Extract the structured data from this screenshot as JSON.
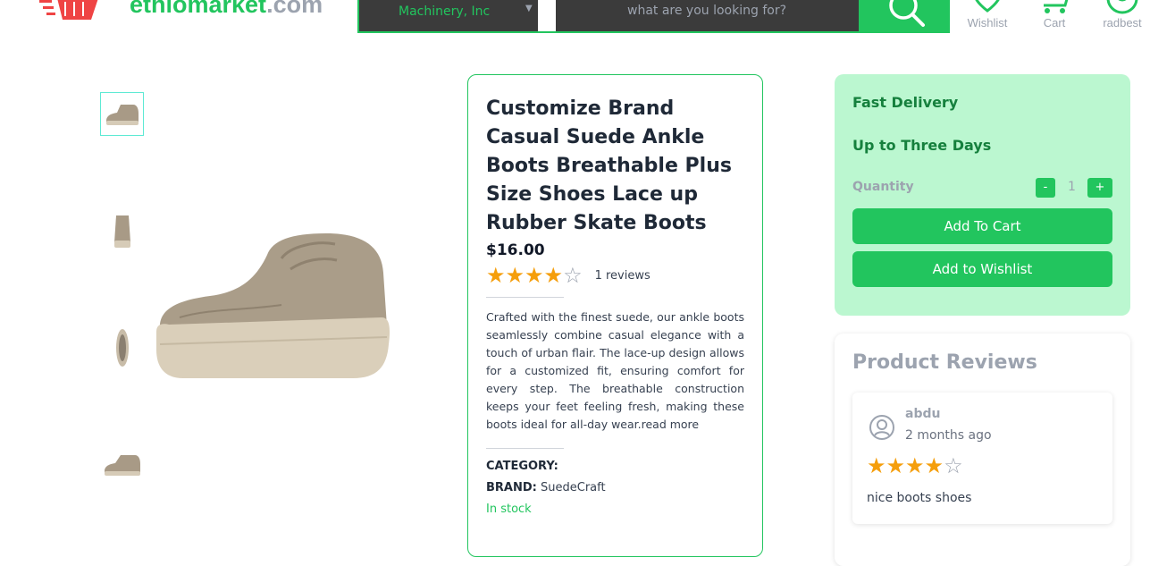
{
  "header": {
    "brand_name": "ethiomarket",
    "brand_tld": ".com",
    "category_selected": "Machinery, Inc",
    "search_placeholder": "what are you looking for?",
    "nav": [
      {
        "label": "Wishlist",
        "icon": "heart-icon"
      },
      {
        "label": "Cart",
        "icon": "cart-icon"
      },
      {
        "label": "radbest",
        "icon": "user-icon"
      }
    ]
  },
  "product": {
    "title": "Customize Brand Casual Suede Ankle Boots Breathable Plus Size Shoes Lace up Rubber Skate Boots",
    "price": "$16.00",
    "rating": 4,
    "rating_max": 5,
    "reviews_text": "1 reviews",
    "description": "Crafted with the finest suede, our ankle boots seamlessly combine casual elegance with a touch of urban flair. The lace-up design allows for a customized fit, ensuring comfort for every step. The breathable construction keeps your feet feeling fresh, making these boots ideal for all-day wear.",
    "read_more": "read more",
    "category_label": "CATEGORY:",
    "category_value": "",
    "brand_label": "BRAND:",
    "brand_value": "SuedeCraft",
    "stock": "In stock",
    "thumbnails": [
      "side view",
      "back view",
      "sole view",
      "side view small"
    ]
  },
  "purchase": {
    "delivery_title": "Fast Delivery",
    "delivery_time": "Up to Three Days",
    "quantity_label": "Quantity",
    "minus": "-",
    "quantity": "1",
    "plus": "+",
    "add_to_cart": "Add To Cart",
    "add_to_wishlist": "Add to Wishlist"
  },
  "reviews": {
    "heading": "Product Reviews",
    "items": [
      {
        "name": "abdu",
        "date": "2 months ago",
        "rating": 4,
        "text": "nice boots shoes"
      }
    ]
  },
  "colors": {
    "accent": "#22c55e",
    "panel_bg": "#bbf7d0",
    "star": "#f59e0b",
    "search_bg": "#3b3b3b"
  }
}
